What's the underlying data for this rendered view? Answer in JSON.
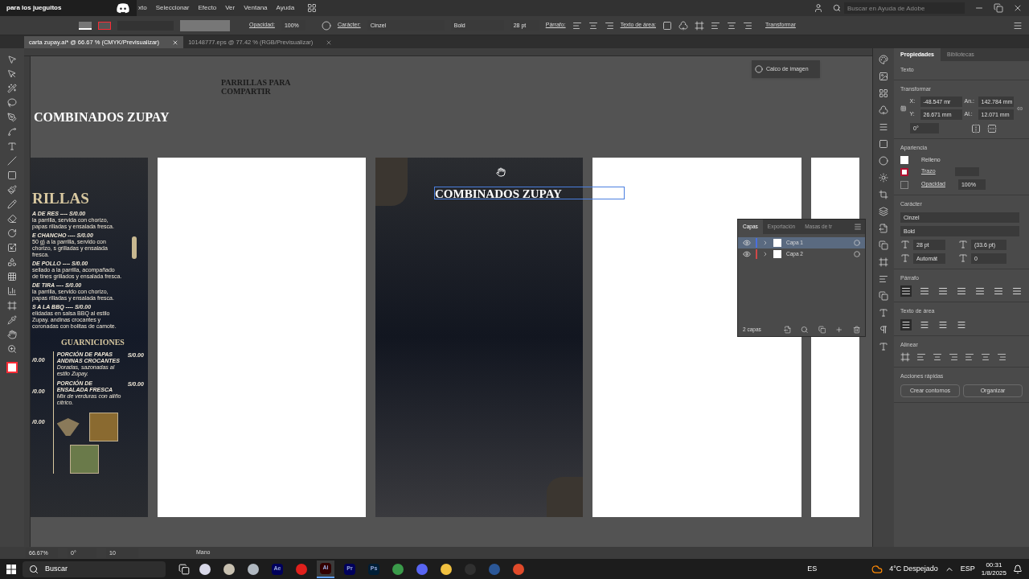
{
  "overlay": {
    "title": "para los jueguitos"
  },
  "menu": [
    "xto",
    "Seleccionar",
    "Efecto",
    "Ver",
    "Ventana",
    "Ayuda"
  ],
  "help_search": {
    "placeholder": "Buscar en Ayuda de Adobe"
  },
  "control_bar": {
    "opacity_label": "Opacidad:",
    "opacity": "100%",
    "character_label": "Carácter:",
    "font": "Cinzel",
    "style": "Bold",
    "size": "28 pt",
    "paragraph_label": "Párrafo:",
    "area_text_label": "Texto de área:",
    "transform_label": "Transformar"
  },
  "document_tabs": [
    {
      "label": "carta zupay.ai* @ 66.67 % (CMYK/Previsualizar)",
      "selected": true
    },
    {
      "label": "10148777.eps @ 77.42 % (RGB/Previsualizar)",
      "selected": false
    }
  ],
  "canvas": {
    "labels": [
      "PARRILLAS PARA COMPARTIR",
      "COMBINADOS ZUPAY"
    ],
    "artboards": [
      {
        "kind": "menu",
        "heading": "RILLAS",
        "items": [
          {
            "name": "A DE RES  ----  S/0.00",
            "desc": "la parrilla, servida con chorizo, papas rilladas y ensalada fresca."
          },
          {
            "name": "E CHANCHO  ----  S/0.00",
            "desc": "50 g) a la parrilla, servido con chorizo, s grilladas y ensalada fresca."
          },
          {
            "name": "DE POLLO  ----  S/0.00",
            "desc": "sellado a la parrilla, acompañado de tines grillados y ensalada fresca."
          },
          {
            "name": "DE TIRA  ----  S/0.00",
            "desc": "la parrilla, servido con chorizo, papas rilladas y ensalada fresca."
          },
          {
            "name": "S A LA BBQ  ----  S/0.00",
            "desc": "elidadas en salsa BBQ al estilo Zupay. andinas crocantes y coronadas con bolitas de camote."
          }
        ],
        "side_heading": "GUARNICIONES",
        "left_prices": [
          "/0.00",
          "/0.00",
          "/0.00"
        ],
        "sides": [
          {
            "name": "PORCIÓN DE PAPAS ANDINAS CROCANTES",
            "price": "S/0.00",
            "desc": "Doradas, sazonadas al estilo Zupay."
          },
          {
            "name": "PORCIÓN DE ENSALADA FRESCA",
            "price": "S/0.00",
            "desc": "Mix de verduras con aliño cítrico."
          }
        ]
      },
      {
        "kind": "blank"
      },
      {
        "kind": "dark",
        "text": "COMBINADOS ZUPAY",
        "selected": true
      },
      {
        "kind": "blank"
      },
      {
        "kind": "blank"
      }
    ]
  },
  "trace_button": "Calco de imagen",
  "layers_panel": {
    "tabs": [
      {
        "label": "Capas",
        "selected": true
      },
      {
        "label": "Exportación",
        "selected": false
      },
      {
        "label": "Masas de tr",
        "selected": false
      }
    ],
    "layers": [
      {
        "name": "Capa 1",
        "color": "#4a6fe0",
        "selected": true,
        "visible": true
      },
      {
        "name": "Capa 2",
        "color": "#d04848",
        "selected": false,
        "visible": true
      }
    ],
    "count": "2 capas"
  },
  "properties": {
    "tabs": [
      {
        "label": "Propiedades",
        "selected": true
      },
      {
        "label": "Bibliotecas",
        "selected": false
      }
    ],
    "type": "Texto",
    "transform": {
      "title": "Transformar",
      "x_label": "X:",
      "x": "-48.547 mr",
      "y_label": "Y:",
      "y": "26.671 mm",
      "w_label": "An.:",
      "w": "142.784 mm",
      "h_label": "Al.:",
      "h": "12.071 mm",
      "angle": "0°"
    },
    "appearance": {
      "title": "Apariencia",
      "fill": "Relleno",
      "stroke": "Trazo",
      "opacity_label": "Opacidad",
      "opacity": "100%"
    },
    "character": {
      "title": "Carácter",
      "font": "Cinzel",
      "style": "Bold",
      "size": "28 pt",
      "leading": "(33.6 pt)",
      "kerning": "Automát",
      "tracking": "0"
    },
    "paragraph": {
      "title": "Párrafo",
      "align": [
        {
          "selected": true
        },
        {
          "selected": false
        },
        {
          "selected": false
        },
        {
          "selected": false
        },
        {
          "selected": false
        },
        {
          "selected": false
        },
        {
          "selected": false
        }
      ]
    },
    "area_text": {
      "title": "Texto de área",
      "align": [
        {
          "selected": true
        },
        {
          "selected": false
        },
        {
          "selected": false
        },
        {
          "selected": false
        }
      ]
    },
    "align_title": "Alinear",
    "quick_actions": {
      "title": "Acciones rápidas",
      "buttons": [
        "Crear contornos",
        "Organizar"
      ]
    }
  },
  "status_bar": {
    "zoom": "66.67%",
    "rotation": "0°",
    "artboard": "10",
    "tool": "Mano"
  },
  "taskbar": {
    "search": "Buscar",
    "apps": [
      {
        "kind": "picture",
        "color": "#d8d8e8",
        "selected": false
      },
      {
        "kind": "picture",
        "color": "#c8c0b0",
        "selected": false
      },
      {
        "kind": "picture",
        "color": "#b0b8c0",
        "selected": false
      },
      {
        "kind": "glyph",
        "label": "Ae",
        "color": "#00005b",
        "selected": false
      },
      {
        "kind": "picture",
        "color": "#e0201c",
        "selected": false
      },
      {
        "kind": "glyph",
        "label": "Ai",
        "color": "#330000",
        "selected": true
      },
      {
        "kind": "glyph",
        "label": "Pr",
        "color": "#00005b",
        "selected": false
      },
      {
        "kind": "glyph",
        "label": "Ps",
        "color": "#001e36",
        "selected": false
      },
      {
        "kind": "picture",
        "color": "#3a9a4a",
        "selected": false
      },
      {
        "kind": "picture",
        "color": "#5865f2",
        "selected": false
      },
      {
        "kind": "picture",
        "color": "#f0c040",
        "selected": false
      },
      {
        "kind": "picture",
        "color": "#303030",
        "selected": false
      },
      {
        "kind": "picture",
        "color": "#2b5797",
        "selected": false
      },
      {
        "kind": "picture",
        "color": "#e04a2a",
        "selected": false
      }
    ],
    "language": "ES",
    "weather": "4°C Despejado",
    "keyboard": "ESP",
    "time": "00:31",
    "date": "1/8/2025"
  }
}
